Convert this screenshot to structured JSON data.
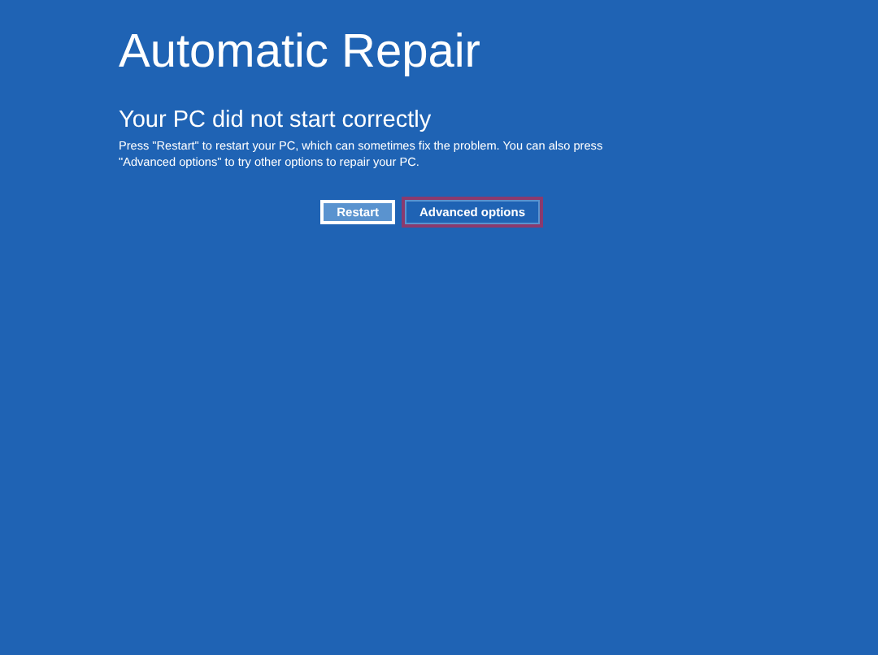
{
  "title": "Automatic Repair",
  "heading": "Your PC did not start correctly",
  "message": "Press \"Restart\" to restart your PC, which can sometimes fix the problem. You can also press \"Advanced options\" to try other options to repair your PC.",
  "buttons": [
    {
      "label": "Restart",
      "focused": true,
      "highlighted": false
    },
    {
      "label": "Advanced options",
      "focused": false,
      "highlighted": true
    }
  ]
}
